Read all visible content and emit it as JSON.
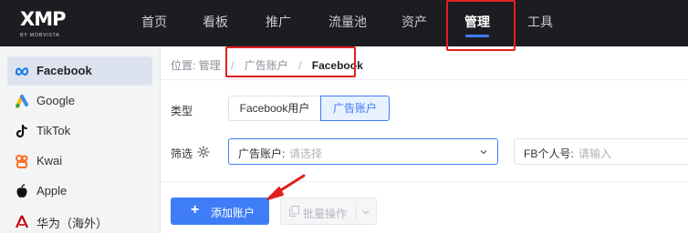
{
  "logo": {
    "mark": "XMP",
    "sub": "BY MOBVISTA"
  },
  "topnav": {
    "items": [
      {
        "label": "首页"
      },
      {
        "label": "看板"
      },
      {
        "label": "推广"
      },
      {
        "label": "流量池"
      },
      {
        "label": "资产"
      },
      {
        "label": "管理",
        "active": true
      },
      {
        "label": "工具"
      }
    ]
  },
  "sidebar": {
    "items": [
      {
        "label": "Facebook",
        "icon": "meta-icon",
        "active": true
      },
      {
        "label": "Google",
        "icon": "google-ads-icon"
      },
      {
        "label": "TikTok",
        "icon": "tiktok-icon"
      },
      {
        "label": "Kwai",
        "icon": "kwai-icon"
      },
      {
        "label": "Apple",
        "icon": "apple-icon"
      },
      {
        "label": "华为（海外）",
        "icon": "huawei-icon"
      }
    ]
  },
  "breadcrumb": {
    "position": "位置: 管理",
    "sep": "/",
    "level2": "广告账户",
    "current": "Facebook"
  },
  "type_filter": {
    "label": "类型",
    "options": [
      {
        "label": "Facebook用户"
      },
      {
        "label": "广告账户",
        "selected": true
      }
    ]
  },
  "filter": {
    "label": "筛选",
    "account_select": {
      "prefix": "广告账户:",
      "placeholder": "请选择"
    },
    "fb_input": {
      "prefix": "FB个人号:",
      "placeholder": "请输入"
    }
  },
  "actions": {
    "add_account": "添加账户",
    "batch": "批量操作"
  },
  "colors": {
    "accent": "#3f7df6",
    "nav_bg": "#1c1d21",
    "annotation": "#e02020"
  }
}
